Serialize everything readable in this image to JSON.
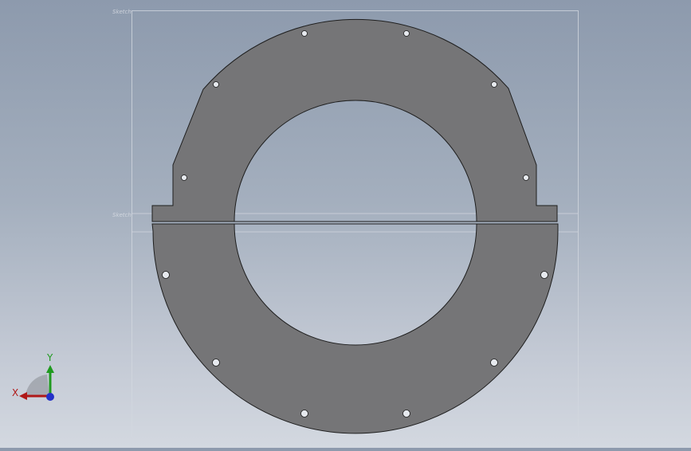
{
  "viewport": {
    "plane_labels": {
      "top": "Sketch",
      "front": "Sketch"
    }
  },
  "part": {
    "fill_color": "#757577",
    "edge_color": "#1e1e1e",
    "hole_fill": "#e6e9ee"
  },
  "triad": {
    "x_label": "X",
    "y_label": "Y",
    "x_color": "#b01818",
    "y_color": "#1f9a1f",
    "z_color": "#2431c8"
  },
  "colors": {
    "plane_line": "#d2d7df"
  }
}
